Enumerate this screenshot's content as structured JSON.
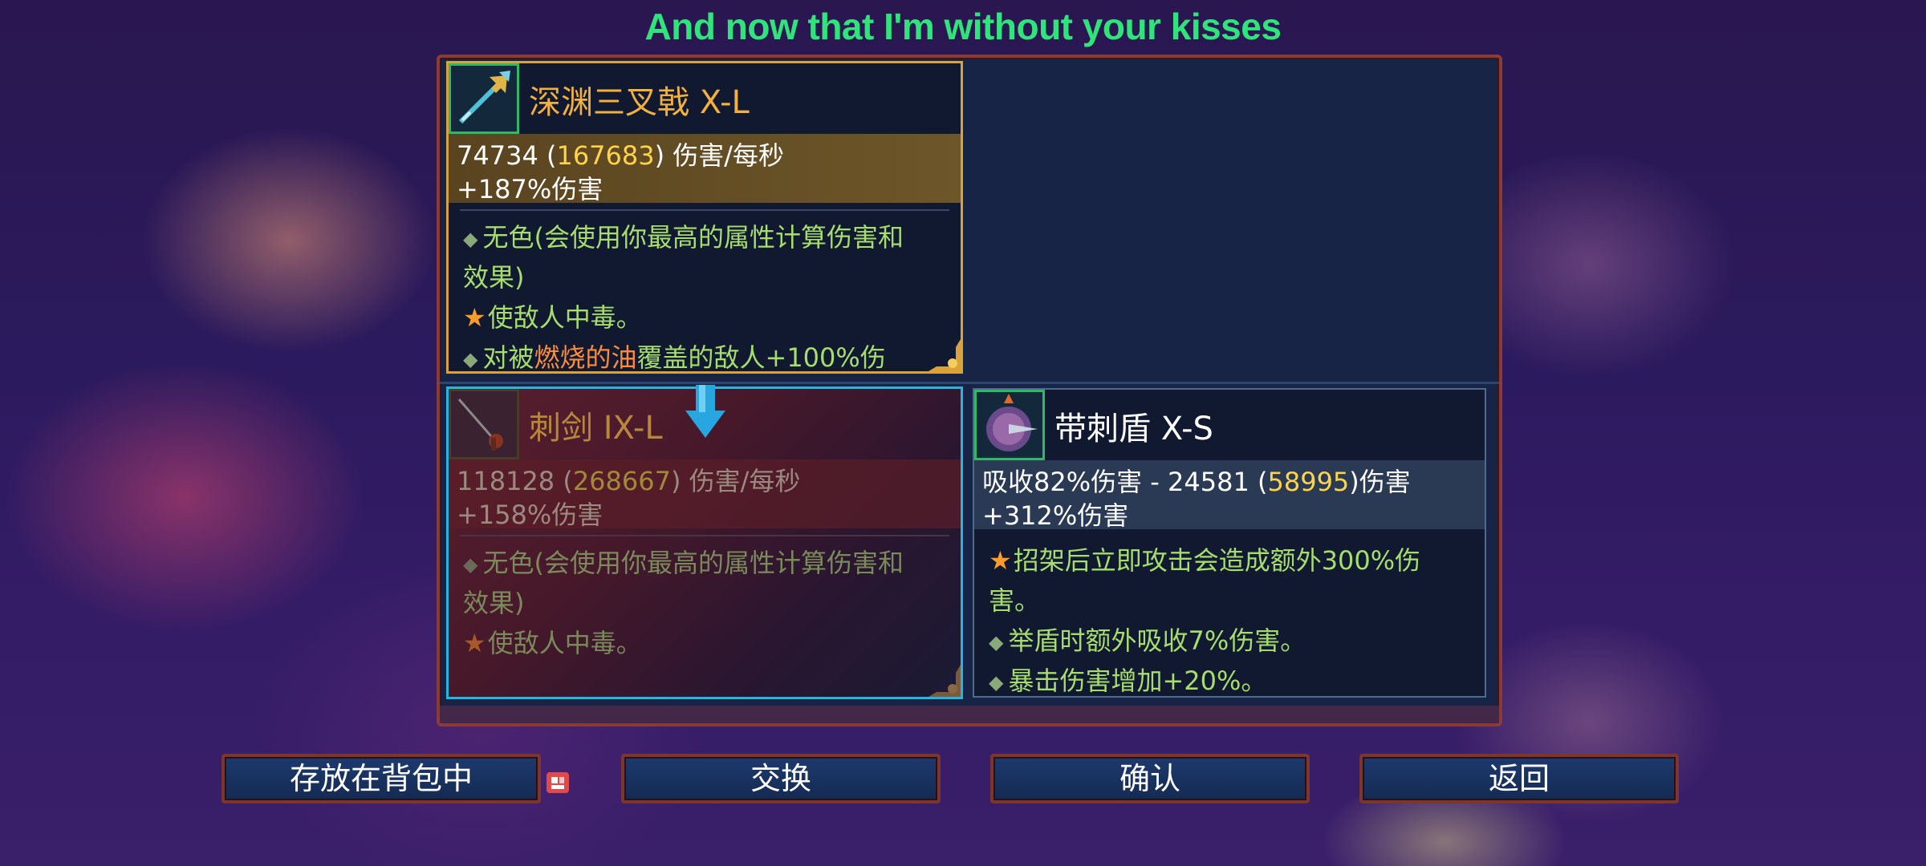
{
  "caption": "And now that I'm without your kisses",
  "new_item": {
    "icon": "trident-icon",
    "name": "深渊三叉戟 X-L",
    "dps": "74734",
    "dps_max": "167683",
    "dps_unit": "伤害/每秒",
    "bonus": "+187%伤害",
    "lines": [
      "无色(会使用你最高的属性计算伤害和",
      "效果)",
      "使敌人中毒。",
      "对被",
      "燃烧的油",
      "覆盖的敌人+100%伤"
    ]
  },
  "old_item": {
    "icon": "dagger-icon",
    "name": "刺剑 IX-L",
    "dps": "118128",
    "dps_max": "268667",
    "dps_unit": "伤害/每秒",
    "bonus": "+158%伤害",
    "lines": [
      "无色(会使用你最高的属性计算伤害和",
      "效果)",
      "使敌人中毒。"
    ]
  },
  "shield_item": {
    "icon": "spiked-shield-icon",
    "name": "带刺盾 X-S",
    "absorb": "吸收82%伤害 - 24581 (",
    "absorb_max": "58995",
    "absorb_tail": ")伤害",
    "bonus": "+312%伤害",
    "lines": [
      "招架后立即攻击会造成额外300%伤",
      "害。",
      "举盾时额外吸收7%伤害。",
      "暴击伤害增加+20%。"
    ]
  },
  "buttons": {
    "store": "存放在背包中",
    "swap": "交换",
    "confirm": "确认",
    "back": "返回"
  }
}
